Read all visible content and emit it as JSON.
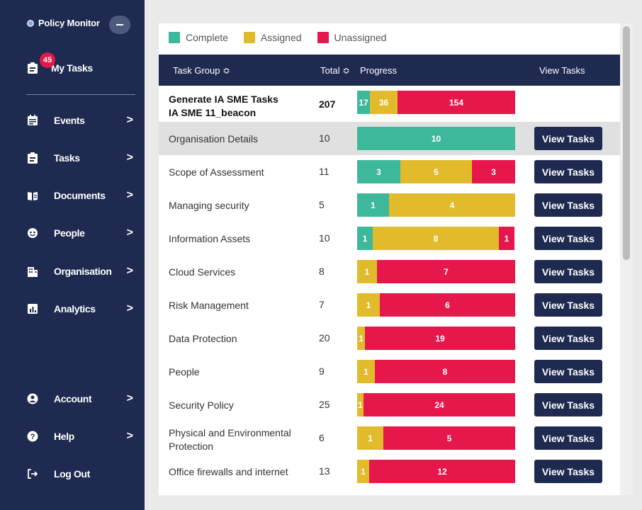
{
  "app": {
    "title": "Policy Monitor"
  },
  "sidebar": {
    "my_tasks": {
      "label": "My Tasks",
      "badge": "45"
    },
    "items": [
      {
        "label": "Events",
        "icon": "calendar-icon"
      },
      {
        "label": "Tasks",
        "icon": "clipboard-icon"
      },
      {
        "label": "Documents",
        "icon": "book-icon"
      },
      {
        "label": "People",
        "icon": "face-icon"
      },
      {
        "label": "Organisation",
        "icon": "building-icon"
      },
      {
        "label": "Analytics",
        "icon": "chart-icon"
      }
    ],
    "bottom": [
      {
        "label": "Account",
        "icon": "user-circle-icon"
      },
      {
        "label": "Help",
        "icon": "help-icon"
      },
      {
        "label": "Log Out",
        "icon": "logout-icon"
      }
    ],
    "chevron": ">"
  },
  "legend": [
    {
      "label": "Complete",
      "color": "#3db89a"
    },
    {
      "label": "Assigned",
      "color": "#e2bb2d"
    },
    {
      "label": "Unassigned",
      "color": "#e5174b"
    }
  ],
  "table": {
    "headers": {
      "group": "Task Group ≎",
      "total": "Total ≎",
      "progress": "Progress",
      "view": "View Tasks"
    },
    "summary": {
      "group_line1": "Generate IA SME Tasks",
      "group_line2": "IA SME 11_beacon",
      "total": "207",
      "complete": 17,
      "assigned": 36,
      "unassigned": 154
    },
    "rows": [
      {
        "group": "Organisation Details",
        "total": "10",
        "complete": 10,
        "assigned": 0,
        "unassigned": 0,
        "button": "View Tasks"
      },
      {
        "group": "Scope of Assessment",
        "total": "11",
        "complete": 3,
        "assigned": 5,
        "unassigned": 3,
        "button": "View Tasks"
      },
      {
        "group": "Managing security",
        "total": "5",
        "complete": 1,
        "assigned": 4,
        "unassigned": 0,
        "button": "View Tasks"
      },
      {
        "group": "Information Assets",
        "total": "10",
        "complete": 1,
        "assigned": 8,
        "unassigned": 1,
        "button": "View Tasks"
      },
      {
        "group": "Cloud Services",
        "total": "8",
        "complete": 0,
        "assigned": 1,
        "unassigned": 7,
        "button": "View Tasks"
      },
      {
        "group": "Risk Management",
        "total": "7",
        "complete": 0,
        "assigned": 1,
        "unassigned": 6,
        "button": "View Tasks"
      },
      {
        "group": "Data Protection",
        "total": "20",
        "complete": 0,
        "assigned": 1,
        "unassigned": 19,
        "button": "View Tasks"
      },
      {
        "group": "People",
        "total": "9",
        "complete": 0,
        "assigned": 1,
        "unassigned": 8,
        "button": "View Tasks"
      },
      {
        "group": "Security Policy",
        "total": "25",
        "complete": 0,
        "assigned": 1,
        "unassigned": 24,
        "button": "View Tasks"
      },
      {
        "group": "Physical and Environmental Protection",
        "total": "6",
        "complete": 0,
        "assigned": 1,
        "unassigned": 5,
        "button": "View Tasks"
      },
      {
        "group": "Office firewalls and internet",
        "total": "13",
        "complete": 0,
        "assigned": 1,
        "unassigned": 12,
        "button": "View Tasks"
      }
    ]
  }
}
